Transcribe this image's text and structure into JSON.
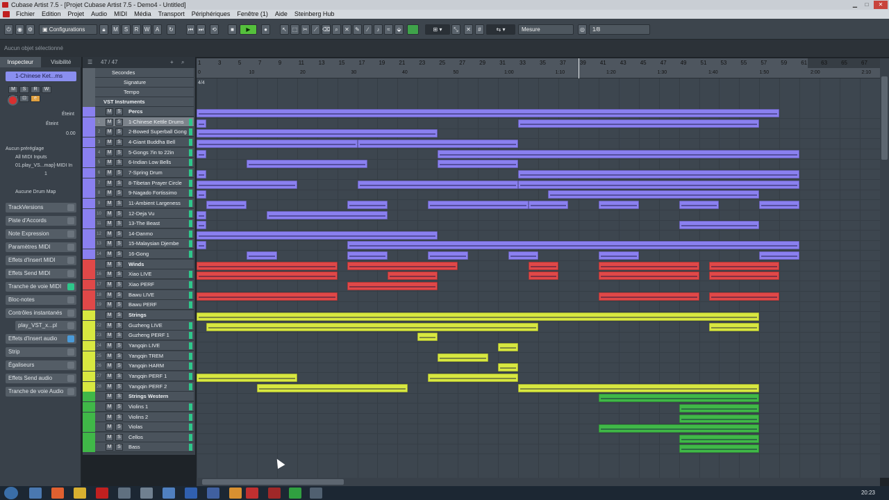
{
  "window": {
    "title": "Cubase Artist 7.5 - [Projet Cubase Artist 7.5 - Demo4 - Untitled]"
  },
  "menu": [
    "Fichier",
    "Edition",
    "Projet",
    "Audio",
    "MIDI",
    "Média",
    "Transport",
    "Périphériques",
    "Fenêtre (1)",
    "Aide",
    "Steinberg Hub"
  ],
  "toolbar": {
    "configurations": "Configurations",
    "msrwa": [
      "M",
      "S",
      "R",
      "W",
      "A"
    ],
    "snap_mode": "Mesure",
    "quantize": "1/8"
  },
  "status": "Aucun objet sélectionné",
  "inspector": {
    "tabs": [
      "Inspecteur",
      "Visibilité"
    ],
    "track_name": "1-Chinese Ket...ms",
    "state": "Éteint",
    "state_value": "0.00",
    "preset": "Aucun préréglage",
    "midi_in": "All MIDI Inputs",
    "midi_out": "01.play_VS...map]-MIDI In",
    "channel": "1",
    "drum_map": "Aucune Drum Map",
    "sections": [
      "TrackVersions",
      "Piste d'Accords",
      "Note Expression",
      "Paramètres MIDI",
      "Effets d'Insert MIDI",
      "Effets Send MIDI",
      "Tranche de voie MIDI",
      "Bloc-notes",
      "Contrôles instantanés",
      "play_VST_x...pl",
      "Effets d'Insert audio",
      "Strip",
      "Égaliseurs",
      "Effets Send audio",
      "Tranche de voie Audio"
    ]
  },
  "tracklist": {
    "count": "47 / 47",
    "global_tracks": [
      "Secondes",
      "Signature",
      "Tempo"
    ],
    "folder_vst": "VST Instruments",
    "tracks": [
      {
        "num": "",
        "name": "Percs",
        "color": "#8a80f0",
        "folder": true
      },
      {
        "num": "1",
        "name": "1-Chinese Kettle Drums",
        "color": "#8a80f0",
        "folder": false
      },
      {
        "num": "2",
        "name": "2-Bowed Superball Gong",
        "color": "#8a80f0",
        "folder": false
      },
      {
        "num": "3",
        "name": "4-Giant Buddha Bell",
        "color": "#8a80f0",
        "folder": false
      },
      {
        "num": "4",
        "name": "5-Gongs 7in to 22in",
        "color": "#8a80f0",
        "folder": false
      },
      {
        "num": "5",
        "name": "6-Indian Low Bells",
        "color": "#8a80f0",
        "folder": false
      },
      {
        "num": "6",
        "name": "7-Spring Drum",
        "color": "#8a80f0",
        "folder": false
      },
      {
        "num": "7",
        "name": "8-Tibetan Prayer Circle",
        "color": "#8a80f0",
        "folder": false
      },
      {
        "num": "8",
        "name": "9-Nagado Fortissimo",
        "color": "#8a80f0",
        "folder": false
      },
      {
        "num": "9",
        "name": "11-Ambient Largeness",
        "color": "#8a80f0",
        "folder": false
      },
      {
        "num": "10",
        "name": "12-Deja Vu",
        "color": "#8a80f0",
        "folder": false
      },
      {
        "num": "11",
        "name": "13-The Beast",
        "color": "#8a80f0",
        "folder": false
      },
      {
        "num": "12",
        "name": "14-Danmo",
        "color": "#8a80f0",
        "folder": false
      },
      {
        "num": "13",
        "name": "15-Malaysian Djembe",
        "color": "#8a80f0",
        "folder": false
      },
      {
        "num": "14",
        "name": "16-Gong",
        "color": "#8a80f0",
        "folder": false
      },
      {
        "num": "",
        "name": "Winds",
        "color": "#e04848",
        "folder": true
      },
      {
        "num": "16",
        "name": "Xiao LIVE",
        "color": "#e04848",
        "folder": false
      },
      {
        "num": "17",
        "name": "Xiao PERF",
        "color": "#e04848",
        "folder": false
      },
      {
        "num": "18",
        "name": "Bawu LIVE",
        "color": "#e04848",
        "folder": false
      },
      {
        "num": "19",
        "name": "Bawu PERF",
        "color": "#e04848",
        "folder": false
      },
      {
        "num": "",
        "name": "Strings",
        "color": "#d8e840",
        "folder": true
      },
      {
        "num": "22",
        "name": "Guzheng LIVE",
        "color": "#d8e840",
        "folder": false
      },
      {
        "num": "23",
        "name": "Guzheng PERF 1",
        "color": "#d8e840",
        "folder": false
      },
      {
        "num": "24",
        "name": "Yangqin LIVE",
        "color": "#d8e840",
        "folder": false
      },
      {
        "num": "25",
        "name": "Yangqin TREM",
        "color": "#d8e840",
        "folder": false
      },
      {
        "num": "26",
        "name": "Yangqin HARM",
        "color": "#d8e840",
        "folder": false
      },
      {
        "num": "27",
        "name": "Yangqin PERF 1",
        "color": "#d8e840",
        "folder": false
      },
      {
        "num": "28",
        "name": "Yangqin PERF 2",
        "color": "#d8e840",
        "folder": false
      },
      {
        "num": "",
        "name": "Strings Western",
        "color": "#40b848",
        "folder": true
      },
      {
        "num": "",
        "name": "Violins 1",
        "color": "#40b848",
        "folder": false
      },
      {
        "num": "",
        "name": "Violins 2",
        "color": "#40b848",
        "folder": false
      },
      {
        "num": "",
        "name": "Violas",
        "color": "#40b848",
        "folder": false
      },
      {
        "num": "",
        "name": "Cellos",
        "color": "#40b848",
        "folder": false
      },
      {
        "num": "",
        "name": "Bass",
        "color": "#40b848",
        "folder": false
      }
    ]
  },
  "ruler": {
    "bars": [
      "1",
      "3",
      "5",
      "7",
      "9",
      "11",
      "13",
      "15",
      "17",
      "19",
      "21",
      "23",
      "25",
      "27",
      "29",
      "31",
      "33",
      "35",
      "37",
      "39",
      "41",
      "43",
      "45",
      "47",
      "49",
      "51",
      "53",
      "55",
      "57",
      "59",
      "61",
      "63",
      "65",
      "67"
    ],
    "times": [
      "0",
      "10",
      "20",
      "30",
      "40",
      "50",
      "1:00",
      "1:10",
      "1:20",
      "1:30",
      "1:40",
      "1:50",
      "2:00",
      "2:10"
    ],
    "signature": "4/4",
    "playhead_bar": 39,
    "total_bars": 69
  },
  "parts": [
    [
      [
        1,
        59
      ]
    ],
    [
      [
        1,
        2
      ],
      [
        33,
        57
      ]
    ],
    [
      [
        1,
        25
      ]
    ],
    [
      [
        1,
        17
      ],
      [
        17,
        33
      ]
    ],
    [
      [
        1,
        2
      ],
      [
        25,
        61
      ]
    ],
    [
      [
        6,
        18
      ],
      [
        25,
        33
      ]
    ],
    [
      [
        1,
        2
      ],
      [
        33,
        61
      ]
    ],
    [
      [
        1,
        11
      ],
      [
        17,
        33
      ],
      [
        33,
        61
      ]
    ],
    [
      [
        1,
        2
      ],
      [
        36,
        57
      ]
    ],
    [
      [
        2,
        6
      ],
      [
        16,
        20
      ],
      [
        24,
        34
      ],
      [
        34,
        38
      ],
      [
        41,
        45
      ],
      [
        49,
        53
      ],
      [
        57,
        61
      ]
    ],
    [
      [
        1,
        2
      ],
      [
        8,
        20
      ]
    ],
    [
      [
        1,
        2
      ],
      [
        49,
        57
      ]
    ],
    [
      [
        1,
        25
      ]
    ],
    [
      [
        1,
        2
      ],
      [
        16,
        61
      ]
    ],
    [
      [
        6,
        9
      ],
      [
        16,
        20
      ],
      [
        24,
        28
      ],
      [
        32,
        35
      ],
      [
        41,
        45
      ],
      [
        57,
        61
      ]
    ],
    [
      [
        1,
        15
      ],
      [
        16,
        27
      ],
      [
        34,
        37
      ],
      [
        41,
        51
      ],
      [
        52,
        59
      ]
    ],
    [
      [
        1,
        15
      ],
      [
        20,
        25
      ],
      [
        34,
        37
      ],
      [
        41,
        51
      ],
      [
        52,
        59
      ]
    ],
    [
      [
        16,
        25
      ]
    ],
    [
      [
        1,
        15
      ],
      [
        41,
        51
      ],
      [
        52,
        59
      ]
    ],
    [],
    [
      [
        1,
        57
      ]
    ],
    [
      [
        2,
        35
      ],
      [
        52,
        57
      ]
    ],
    [
      [
        23,
        25
      ]
    ],
    [
      [
        31,
        33
      ]
    ],
    [
      [
        25,
        30
      ]
    ],
    [
      [
        31,
        33
      ]
    ],
    [
      [
        1,
        11
      ],
      [
        24,
        33
      ]
    ],
    [
      [
        7,
        22
      ],
      [
        33,
        57
      ]
    ],
    [
      [
        41,
        57
      ]
    ],
    [
      [
        49,
        57
      ]
    ],
    [
      [
        49,
        57
      ]
    ],
    [
      [
        41,
        57
      ]
    ],
    [
      [
        49,
        57
      ]
    ],
    [
      [
        49,
        57
      ]
    ]
  ],
  "taskbar": {
    "clock": "20:23"
  }
}
